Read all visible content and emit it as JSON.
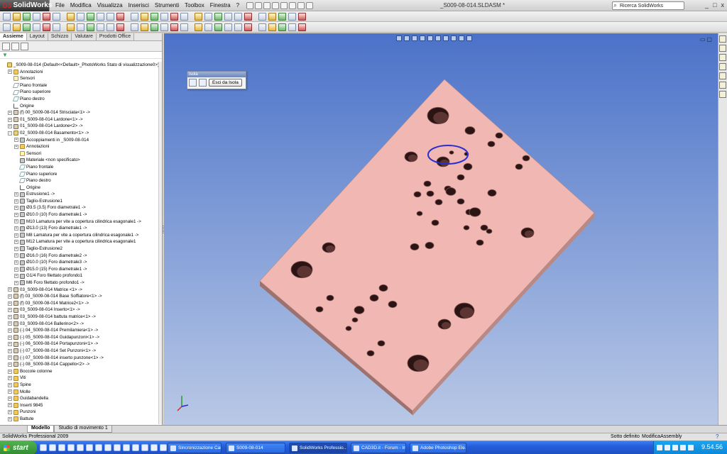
{
  "app": {
    "brand": "SolidWorks",
    "document_title": "_S009-08-014.SLDASM *",
    "menu": [
      "File",
      "Modifica",
      "Visualizza",
      "Inserisci",
      "Strumenti",
      "Toolbox",
      "Finestra",
      "?"
    ],
    "search_placeholder": "Ricerca SolidWorks",
    "window_buttons": [
      "_",
      "□",
      "x"
    ]
  },
  "command_tabs": [
    "Assieme",
    "Layout",
    "Schizzo",
    "Valutare",
    "Prodotti Office"
  ],
  "island": {
    "title": "Isola",
    "exit_button": "Esci da Isola"
  },
  "tree": [
    {
      "label": "_S009-08-014  (Default<<Default>_PhotoWorks Stato di visualizzazione0>)",
      "icon": "assembly",
      "expander": "",
      "indent": 0
    },
    {
      "label": "Annotazioni",
      "icon": "folder",
      "expander": "+",
      "indent": 1
    },
    {
      "label": "Sensori",
      "icon": "sensor",
      "expander": "",
      "indent": 1
    },
    {
      "label": "Piano frontale",
      "icon": "plane",
      "expander": "",
      "indent": 1
    },
    {
      "label": "Piano superiore",
      "icon": "plane",
      "expander": "",
      "indent": 1
    },
    {
      "label": "Piano destro",
      "icon": "plane",
      "expander": "",
      "indent": 1
    },
    {
      "label": "Origine",
      "icon": "origin",
      "expander": "",
      "indent": 1
    },
    {
      "label": "(f) 00_S009-08-014 Strisciata<1> ->",
      "icon": "part",
      "expander": "+",
      "indent": 1
    },
    {
      "label": "01_S009-08-014 Lardone<1> ->",
      "icon": "part",
      "expander": "+",
      "indent": 1
    },
    {
      "label": "01_S009-08-014 Lardone<2> ->",
      "icon": "part",
      "expander": "+",
      "indent": 1
    },
    {
      "label": "02_S009-08-014 Basamento<1> ->",
      "icon": "assembly",
      "expander": "-",
      "indent": 1
    },
    {
      "label": "Accoppiamenti in _S009-08-014",
      "icon": "feature",
      "expander": "+",
      "indent": 2
    },
    {
      "label": "Annotazioni",
      "icon": "folder",
      "expander": "+",
      "indent": 2
    },
    {
      "label": "Sensori",
      "icon": "sensor",
      "expander": "",
      "indent": 2
    },
    {
      "label": "Materiale <non specificato>",
      "icon": "feature",
      "expander": "",
      "indent": 2
    },
    {
      "label": "Piano frontale",
      "icon": "plane",
      "expander": "",
      "indent": 2
    },
    {
      "label": "Piano superiore",
      "icon": "plane",
      "expander": "",
      "indent": 2
    },
    {
      "label": "Piano destro",
      "icon": "plane",
      "expander": "",
      "indent": 2
    },
    {
      "label": "Origine",
      "icon": "origin",
      "expander": "",
      "indent": 2
    },
    {
      "label": "Estrusione1 ->",
      "icon": "feature",
      "expander": "+",
      "indent": 2
    },
    {
      "label": "Taglio-Estrusione1",
      "icon": "feature",
      "expander": "+",
      "indent": 2
    },
    {
      "label": "Ø3.5 (3.5) Foro diametrale1 ->",
      "icon": "feature",
      "expander": "+",
      "indent": 2
    },
    {
      "label": "Ø10.0 (10) Foro diametrale1 ->",
      "icon": "feature",
      "expander": "+",
      "indent": 2
    },
    {
      "label": "M10 Lamatura per vite a copertura cilindrica esagonale1 ->",
      "icon": "feature",
      "expander": "+",
      "indent": 2
    },
    {
      "label": "Ø13.0 (13) Foro diametrale1 ->",
      "icon": "feature",
      "expander": "+",
      "indent": 2
    },
    {
      "label": "M8 Lamatura per vite a copertura cilindrica esagonale1 ->",
      "icon": "feature",
      "expander": "+",
      "indent": 2
    },
    {
      "label": "M12 Lamatura per vite a copertura cilindrica esagonale1",
      "icon": "feature",
      "expander": "+",
      "indent": 2
    },
    {
      "label": "Taglio-Estrusione2",
      "icon": "feature",
      "expander": "+",
      "indent": 2
    },
    {
      "label": "Ø16.0 (16) Foro diametrale2 ->",
      "icon": "feature",
      "expander": "+",
      "indent": 2
    },
    {
      "label": "Ø10.0 (10) Foro diametrale3 ->",
      "icon": "feature",
      "expander": "+",
      "indent": 2
    },
    {
      "label": "Ø15.0 (15) Foro diametrale1 ->",
      "icon": "feature",
      "expander": "+",
      "indent": 2
    },
    {
      "label": "G1/4 Foro filettato profondo1",
      "icon": "feature",
      "expander": "+",
      "indent": 2
    },
    {
      "label": "M6 Foro filettato profondo1 ->",
      "icon": "feature",
      "expander": "+",
      "indent": 2
    },
    {
      "label": "03_S009-08-014 Matrice <1> ->",
      "icon": "part",
      "expander": "+",
      "indent": 1
    },
    {
      "label": "(f) 03_S009-08-014 Base Soffiatore<1> ->",
      "icon": "part",
      "expander": "+",
      "indent": 1
    },
    {
      "label": "(f) 03_S009-08-014 Matrice2<1> ->",
      "icon": "part",
      "expander": "+",
      "indent": 1
    },
    {
      "label": "03_S009-08-014 Inserto<1> ->",
      "icon": "part",
      "expander": "+",
      "indent": 1
    },
    {
      "label": "03_S009-08-014 battuta matrice<1> ->",
      "icon": "part",
      "expander": "+",
      "indent": 1
    },
    {
      "label": "03_S009-08-014 Ballerino<2> ->",
      "icon": "part",
      "expander": "+",
      "indent": 1
    },
    {
      "label": "(-) 04_S009-08-014  Premilamiera<1> ->",
      "icon": "part",
      "expander": "+",
      "indent": 1
    },
    {
      "label": "(-) 05_S009-08-014 Guidapunzoni<1> ->",
      "icon": "part",
      "expander": "+",
      "indent": 1
    },
    {
      "label": "(-) 06_S009-08-014  Portapunzoni<1> ->",
      "icon": "part",
      "expander": "+",
      "indent": 1
    },
    {
      "label": "(-) 07_S009-08-014 Set Punzoni<1> ->",
      "icon": "part",
      "expander": "+",
      "indent": 1
    },
    {
      "label": "(-) 07_S009-08-014 inserto punzone<1> ->",
      "icon": "part",
      "expander": "+",
      "indent": 1
    },
    {
      "label": "(-) 08_S009-08-014 Cappello<2> ->",
      "icon": "part",
      "expander": "+",
      "indent": 1
    },
    {
      "label": "Boccole colonne",
      "icon": "folder",
      "expander": "+",
      "indent": 1
    },
    {
      "label": "Viti",
      "icon": "folder",
      "expander": "+",
      "indent": 1
    },
    {
      "label": "Spine",
      "icon": "folder",
      "expander": "+",
      "indent": 1
    },
    {
      "label": "Molle",
      "icon": "folder",
      "expander": "+",
      "indent": 1
    },
    {
      "label": "Guidabandella",
      "icon": "folder",
      "expander": "+",
      "indent": 1
    },
    {
      "label": "Inserti 9845",
      "icon": "folder",
      "expander": "+",
      "indent": 1
    },
    {
      "label": "Punzoni",
      "icon": "folder",
      "expander": "+",
      "indent": 1
    },
    {
      "label": "Battute",
      "icon": "folder",
      "expander": "+",
      "indent": 1
    }
  ],
  "bottom_tabs": [
    "Modello",
    "Studio di movimento 1"
  ],
  "status": {
    "product": "SolidWorks Professional 2009",
    "definition": "Sotto definito",
    "mode": "ModificaAssembly",
    "help": "?"
  },
  "taskbar": {
    "start": "start",
    "tasks": [
      {
        "label": "Sincronizzazione Cart...",
        "active": false
      },
      {
        "label": "S009-08-014",
        "active": false
      },
      {
        "label": "SolidWorks Professio...",
        "active": true
      },
      {
        "label": "CAD3D.it - Forum - In...",
        "active": false
      },
      {
        "label": "Adobe Photoshop Ele...",
        "active": false
      }
    ],
    "clock": "9.54.56"
  },
  "colors": {
    "plate_top": "#f0b7b3",
    "plate_front": "#a87d7a",
    "plate_side": "#c69490",
    "viewport_top": "#4b72c9",
    "viewport_bottom": "#b9c8e6",
    "highlight_ellipse": "#2a2fd0"
  }
}
